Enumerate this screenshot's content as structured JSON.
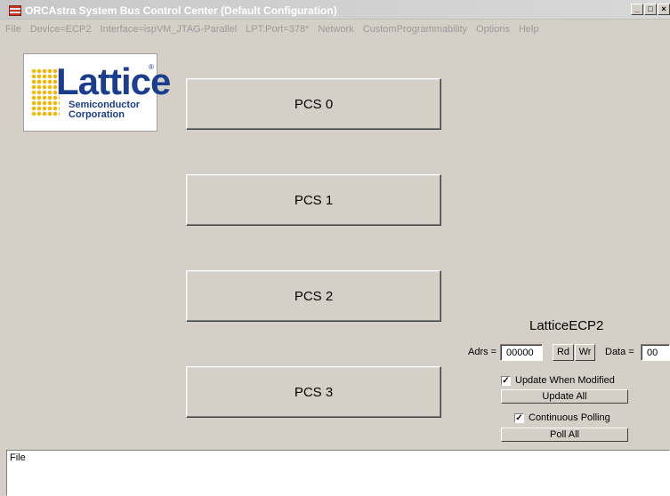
{
  "window": {
    "title": "ORCAstra System Bus Control Center  (Default Configuration)",
    "buttons": [
      "_",
      "□",
      "×"
    ]
  },
  "menu": [
    "File",
    "Device=ECP2",
    "Interface=ispVM_JTAG-Parallel",
    "LPT:Port=378*",
    "Network",
    "CustomProgrammability",
    "Options",
    "Help"
  ],
  "logo": {
    "name": "Lattice",
    "reg": "®",
    "line1": "Semiconductor",
    "line2": "Corporation"
  },
  "pcs_buttons": [
    "PCS 0",
    "PCS 1",
    "PCS 2",
    "PCS 3"
  ],
  "device_panel": {
    "title": "LatticeECP2",
    "adrs_label": "Adrs =",
    "adrs_value": "00000",
    "rd_label": "Rd",
    "wr_label": "Wr",
    "data_label": "Data =",
    "data_value": "00",
    "update_when_modified": {
      "label": "Update When Modified",
      "checked": true
    },
    "update_all_label": "Update All",
    "continuous_polling": {
      "label": "Continuous Polling",
      "checked": true
    },
    "poll_all_label": "Poll All"
  },
  "status": {
    "text": "File"
  },
  "colors": {
    "logo_blue": "#1a3d8f",
    "logo_gold": "#f2b705",
    "face": "#d4d0c8"
  }
}
